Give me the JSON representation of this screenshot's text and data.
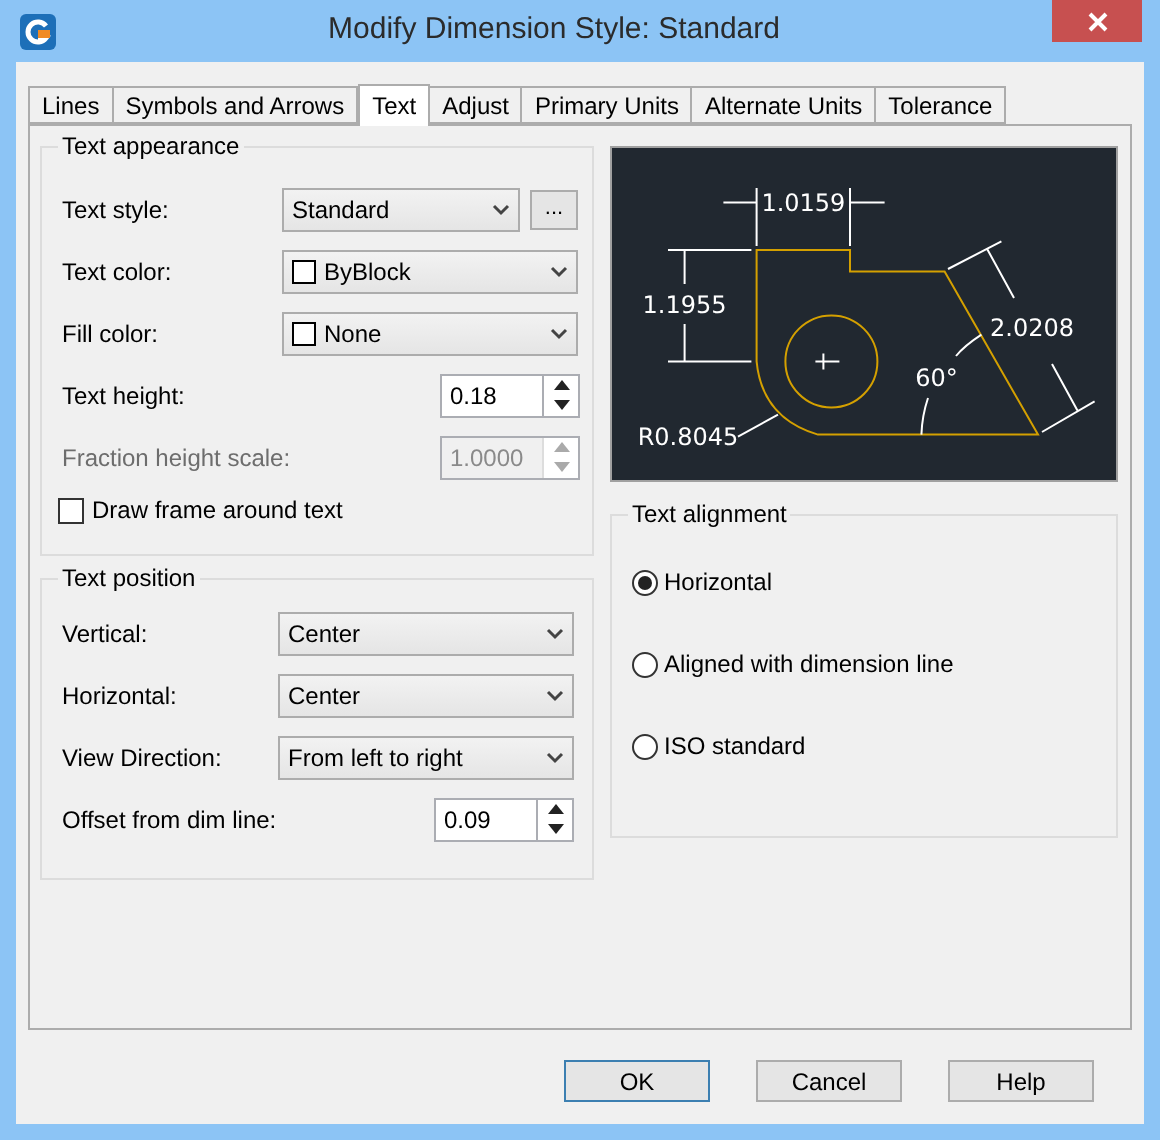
{
  "window": {
    "title": "Modify Dimension Style: Standard"
  },
  "tabs": [
    {
      "label": "Lines",
      "selected": false
    },
    {
      "label": "Symbols and Arrows",
      "selected": false
    },
    {
      "label": "Text",
      "selected": true
    },
    {
      "label": "Adjust",
      "selected": false
    },
    {
      "label": "Primary Units",
      "selected": false
    },
    {
      "label": "Alternate Units",
      "selected": false
    },
    {
      "label": "Tolerance",
      "selected": false
    }
  ],
  "text_appearance": {
    "title": "Text appearance",
    "fields": [
      {
        "kind": "dropdown_button",
        "label": "Text style:",
        "value": "Standard",
        "button_label": "..."
      },
      {
        "kind": "color_dropdown",
        "label": "Text color:",
        "value": "ByBlock"
      },
      {
        "kind": "color_dropdown",
        "label": "Fill color:",
        "value": "None"
      },
      {
        "kind": "spinner",
        "label": "Text height:",
        "value": "0.18",
        "disabled": false
      },
      {
        "kind": "spinner",
        "label": "Fraction height scale:",
        "value": "1.0000",
        "disabled": true
      }
    ],
    "draw_frame": {
      "label": "Draw frame around text",
      "checked": false
    }
  },
  "text_position": {
    "title": "Text position",
    "fields": [
      {
        "kind": "dropdown",
        "label": "Vertical:",
        "value": "Center"
      },
      {
        "kind": "dropdown",
        "label": "Horizontal:",
        "value": "Center"
      },
      {
        "kind": "dropdown",
        "label": "View Direction:",
        "value": "From left to right"
      },
      {
        "kind": "spinner",
        "label": "Offset from dim line:",
        "value": "0.09",
        "disabled": false
      }
    ]
  },
  "preview": {
    "labels": [
      "1.0159",
      "1.1955",
      "2.0208",
      "60°",
      "R0.8045"
    ]
  },
  "text_alignment": {
    "title": "Text alignment",
    "options": [
      {
        "label": "Horizontal",
        "selected": true
      },
      {
        "label": "Aligned with dimension line",
        "selected": false
      },
      {
        "label": "ISO standard",
        "selected": false
      }
    ]
  },
  "buttons": [
    {
      "label": "OK",
      "default": true
    },
    {
      "label": "Cancel",
      "default": false
    },
    {
      "label": "Help",
      "default": false
    }
  ]
}
